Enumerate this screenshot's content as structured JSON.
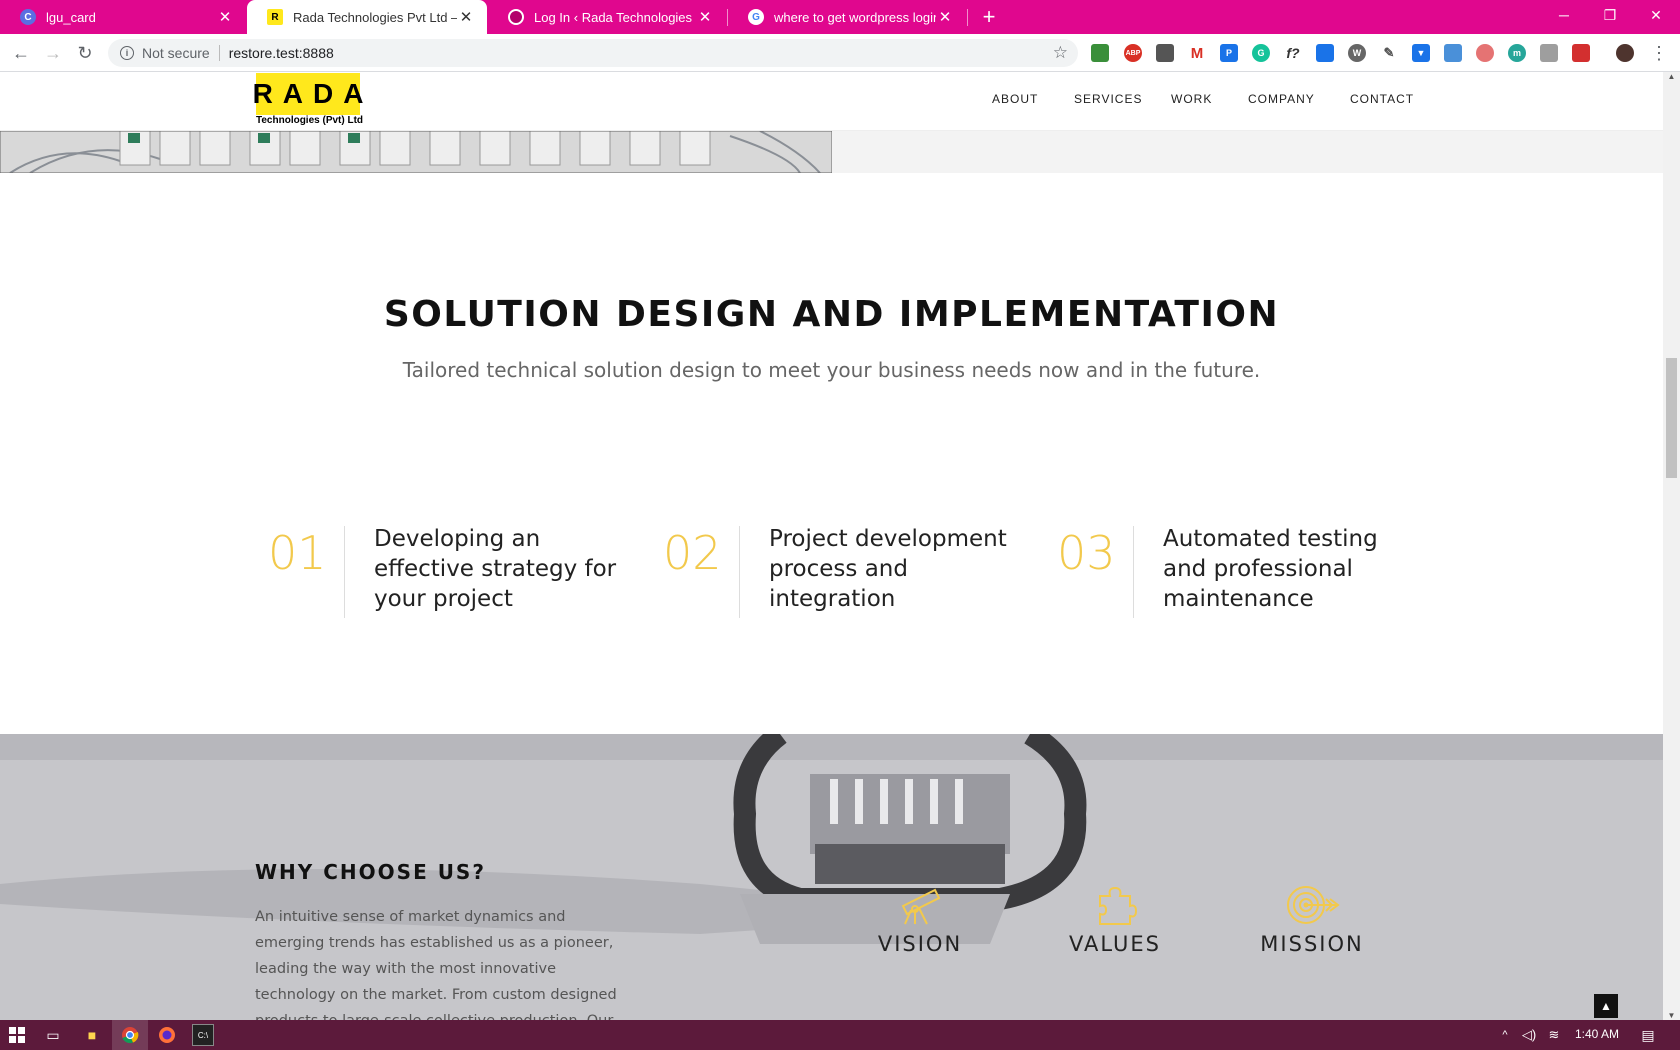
{
  "browser": {
    "tabs": [
      {
        "title": "lgu_card",
        "favicon": "C",
        "favicon_color": "#5b6ee1"
      },
      {
        "title": "Rada Technologies Pvt Ltd – Auto",
        "favicon": "R",
        "favicon_color": "#ffe81c"
      },
      {
        "title": "Log In ‹ Rada Technologies Pvt Lt",
        "favicon": "",
        "favicon_color": "#b3006b"
      },
      {
        "title": "where to get wordpress login pa",
        "favicon": "G",
        "favicon_color": "#ffffff"
      }
    ],
    "security_label": "Not secure",
    "url": "restore.test:8888",
    "extension_badge": "10",
    "accent_color": "#e0078e"
  },
  "site": {
    "logo_text": "RADA",
    "logo_subtext": "Technologies (Pvt) Ltd",
    "nav": [
      "ABOUT",
      "SERVICES",
      "WORK",
      "COMPANY",
      "CONTACT"
    ]
  },
  "solution": {
    "title": "SOLUTION DESIGN AND IMPLEMENTATION",
    "subtitle": "Tailored technical solution design to meet your business needs now and in the future.",
    "steps": [
      {
        "num": "01",
        "text": "Developing an effective strategy for your project"
      },
      {
        "num": "02",
        "text": "Project development process and integration"
      },
      {
        "num": "03",
        "text": "Automated testing and professional maintenance"
      }
    ]
  },
  "why": {
    "title": "WHY CHOOSE US?",
    "body": "An intuitive sense of market dynamics and emerging trends has established us as a pioneer, leading the way with the most innovative technology on the market. From custom designed products to large-scale collective production, Our customers and in",
    "features": [
      {
        "label": "VISION",
        "icon": "telescope-icon"
      },
      {
        "label": "VALUES",
        "icon": "puzzle-icon"
      },
      {
        "label": "MISSION",
        "icon": "target-icon"
      }
    ],
    "icon_color": "#f2c94c"
  },
  "taskbar": {
    "clock": "1:40 AM"
  }
}
